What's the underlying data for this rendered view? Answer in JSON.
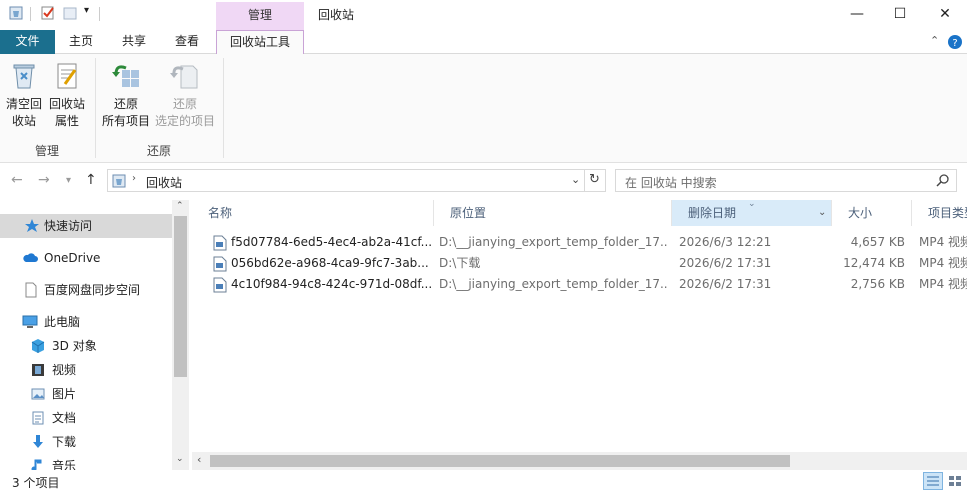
{
  "window": {
    "title": "回收站",
    "context_tab_group": "管理",
    "minimize": "—",
    "maximize": "☐",
    "close": "✕"
  },
  "ribbon_tabs": [
    "文件",
    "主页",
    "共享",
    "查看",
    "回收站工具"
  ],
  "ribbon": {
    "empty_bin": [
      "清空回",
      "收站"
    ],
    "bin_props": [
      "回收站",
      "属性"
    ],
    "restore_all": [
      "还原",
      "所有项目"
    ],
    "restore_selected": [
      "还原",
      "选定的项目"
    ],
    "group_manage": "管理",
    "group_restore": "还原"
  },
  "address": {
    "path": "回收站",
    "search_placeholder": "在 回收站 中搜索"
  },
  "nav": {
    "quick_access": "快速访问",
    "onedrive": "OneDrive",
    "baidu": "百度网盘同步空间",
    "this_pc": "此电脑",
    "objects3d": "3D 对象",
    "videos": "视频",
    "pictures": "图片",
    "documents": "文档",
    "downloads": "下载",
    "music": "音乐"
  },
  "columns": [
    "名称",
    "原位置",
    "删除日期",
    "大小",
    "项目类型"
  ],
  "files": [
    {
      "name": "f5d07784-6ed5-4ec4-ab2a-41cf...",
      "location": "D:\\__jianying_export_temp_folder_17...",
      "deleted": "2026/6/3 12:21",
      "size": "4,657 KB",
      "type": "MP4 视频"
    },
    {
      "name": "056bd62e-a968-4ca9-9fc7-3ab...",
      "location": "D:\\下载",
      "deleted": "2026/6/2 17:31",
      "size": "12,474 KB",
      "type": "MP4 视频"
    },
    {
      "name": "4c10f984-94c8-424c-971d-08df...",
      "location": "D:\\__jianying_export_temp_folder_17...",
      "deleted": "2026/6/2 17:31",
      "size": "2,756 KB",
      "type": "MP4 视频"
    }
  ],
  "status": {
    "count": "3 个项目"
  }
}
